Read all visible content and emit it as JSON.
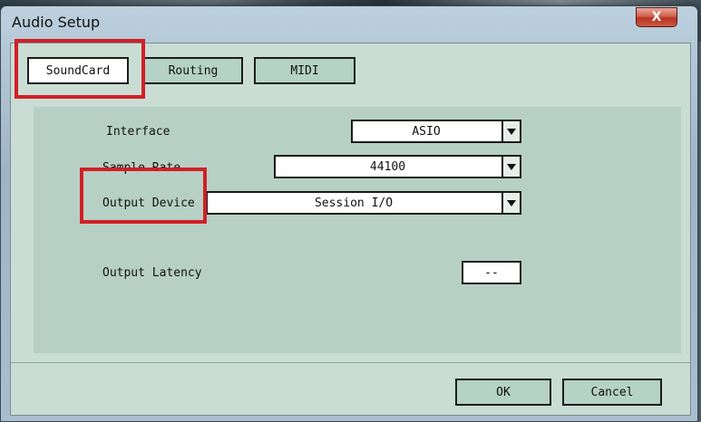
{
  "window": {
    "title": "Audio Setup",
    "close_label": "X"
  },
  "tabs": [
    {
      "label": "SoundCard",
      "active": true
    },
    {
      "label": "Routing",
      "active": false
    },
    {
      "label": "MIDI",
      "active": false
    }
  ],
  "settings": {
    "interface": {
      "label": "Interface",
      "value": "ASIO"
    },
    "sample_rate": {
      "label": "Sample Rate",
      "value": "44100"
    },
    "output_device": {
      "label": "Output Device",
      "value": "Session I/O"
    },
    "output_latency": {
      "label": "Output Latency",
      "value": "--"
    }
  },
  "footer": {
    "ok_label": "OK",
    "cancel_label": "Cancel"
  },
  "colors": {
    "highlight": "#d21f26",
    "client_bg": "#c9ddd5",
    "panel_bg": "#b7d0c6"
  },
  "icons": {
    "close": "close-icon",
    "dropdown": "chevron-down-icon"
  }
}
